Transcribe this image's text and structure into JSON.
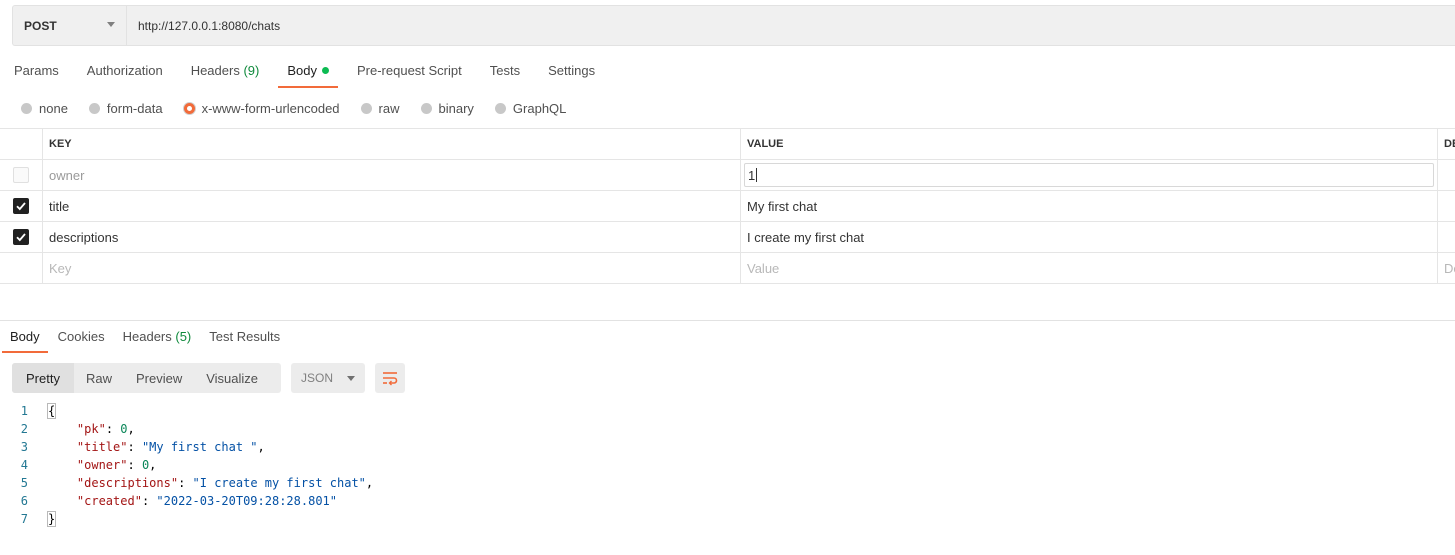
{
  "request": {
    "method": "POST",
    "url": "http://127.0.0.1:8080/chats"
  },
  "request_tabs": [
    {
      "label": "Params"
    },
    {
      "label": "Authorization"
    },
    {
      "label": "Headers",
      "count": "(9)"
    },
    {
      "label": "Body",
      "active": true,
      "indicator": "green-dot"
    },
    {
      "label": "Pre-request Script"
    },
    {
      "label": "Tests"
    },
    {
      "label": "Settings"
    }
  ],
  "body_types": [
    {
      "label": "none"
    },
    {
      "label": "form-data"
    },
    {
      "label": "x-www-form-urlencoded",
      "selected": true
    },
    {
      "label": "raw"
    },
    {
      "label": "binary"
    },
    {
      "label": "GraphQL"
    }
  ],
  "kv_table": {
    "headers": {
      "key": "KEY",
      "value": "VALUE",
      "description": "DE"
    },
    "rows": [
      {
        "checked": false,
        "key": "owner",
        "value": "1",
        "editing": true
      },
      {
        "checked": true,
        "key": "title",
        "value": "My first chat"
      },
      {
        "checked": true,
        "key": "descriptions",
        "value": "I create my first chat"
      }
    ],
    "placeholders": {
      "key": "Key",
      "value": "Value",
      "description": "De"
    }
  },
  "response_tabs": [
    {
      "label": "Body",
      "active": true
    },
    {
      "label": "Cookies"
    },
    {
      "label": "Headers",
      "count": "(5)"
    },
    {
      "label": "Test Results"
    }
  ],
  "view_modes": [
    "Pretty",
    "Raw",
    "Preview",
    "Visualize"
  ],
  "active_view_mode": "Pretty",
  "format": "JSON",
  "icons": {
    "wrap": "wrap-lines-icon",
    "check": "check-icon",
    "caret": "chevron-down-icon"
  },
  "colors": {
    "accent": "#f26b3a",
    "active_dot": "#0cbb52",
    "count": "#0f8a3c",
    "json_key": "#a31515",
    "json_string": "#0451a5",
    "json_number": "#098658"
  },
  "response_lines": [
    {
      "n": "1",
      "text": "{"
    },
    {
      "n": "2",
      "key": "\"pk\"",
      "value": "0",
      "type": "number",
      "comma": ","
    },
    {
      "n": "3",
      "key": "\"title\"",
      "value": "\"My first chat \"",
      "type": "string",
      "comma": ","
    },
    {
      "n": "4",
      "key": "\"owner\"",
      "value": "0",
      "type": "number",
      "comma": ","
    },
    {
      "n": "5",
      "key": "\"descriptions\"",
      "value": "\"I create my first chat\"",
      "type": "string",
      "comma": ","
    },
    {
      "n": "6",
      "key": "\"created\"",
      "value": "\"2022-03-20T09:28:28.801\"",
      "type": "string",
      "comma": ""
    },
    {
      "n": "7",
      "text": "}"
    }
  ]
}
